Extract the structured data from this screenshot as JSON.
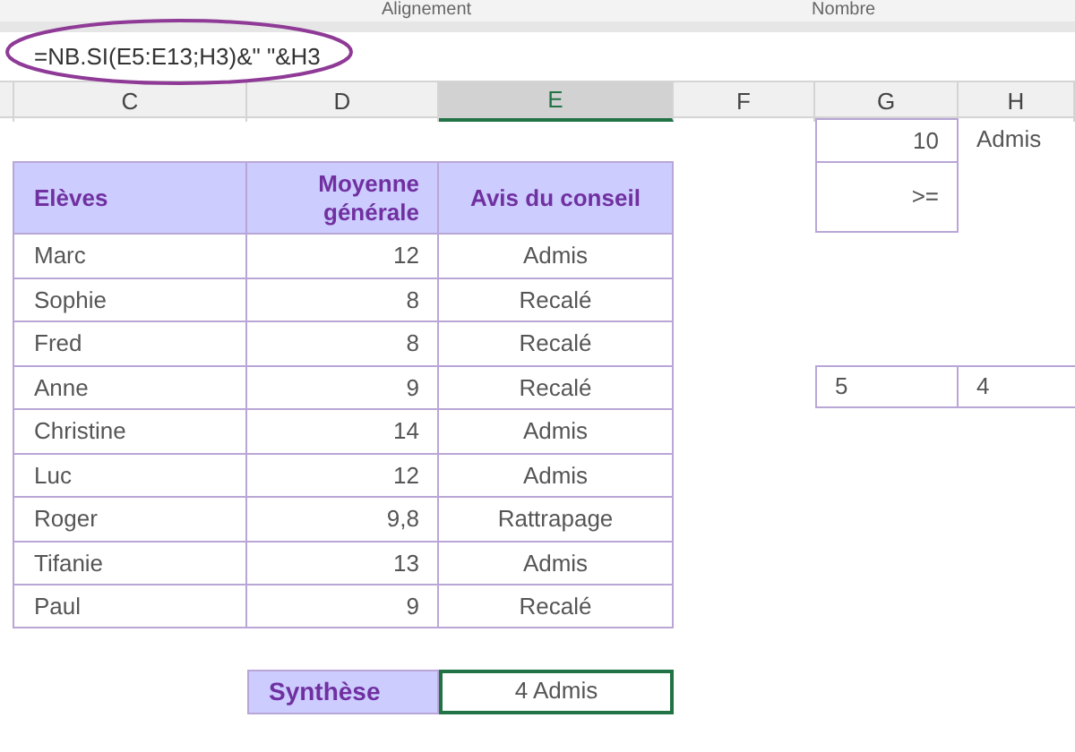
{
  "ribbon": {
    "groups": [
      "Alignement",
      "Nombre"
    ]
  },
  "formula_bar": {
    "formula": "=NB.SI(E5:E13;H3)&\" \"&H3"
  },
  "column_headers": [
    {
      "label": "C",
      "selected": false
    },
    {
      "label": "D",
      "selected": false
    },
    {
      "label": "E",
      "selected": true
    },
    {
      "label": "F",
      "selected": false
    },
    {
      "label": "G",
      "selected": false
    },
    {
      "label": "H",
      "selected": false
    }
  ],
  "criteria": {
    "threshold": "10",
    "label": "Admis",
    "operator": ">="
  },
  "table": {
    "columns": [
      "Elèves",
      "Moyenne générale",
      "Avis du conseil"
    ],
    "rows": [
      {
        "name": "Marc",
        "average": "12",
        "decision": "Admis"
      },
      {
        "name": "Sophie",
        "average": "8",
        "decision": "Recalé"
      },
      {
        "name": "Fred",
        "average": "8",
        "decision": "Recalé"
      },
      {
        "name": "Anne",
        "average": "9",
        "decision": "Recalé"
      },
      {
        "name": "Christine",
        "average": "14",
        "decision": "Admis"
      },
      {
        "name": "Luc",
        "average": "12",
        "decision": "Admis"
      },
      {
        "name": "Roger",
        "average": "9,8",
        "decision": "Rattrapage"
      },
      {
        "name": "Tifanie",
        "average": "13",
        "decision": "Admis"
      },
      {
        "name": "Paul",
        "average": "9",
        "decision": "Recalé"
      }
    ]
  },
  "side_values": [
    "5",
    "4"
  ],
  "summary": {
    "label": "Synthèse",
    "value": "4 Admis",
    "selected": true
  }
}
